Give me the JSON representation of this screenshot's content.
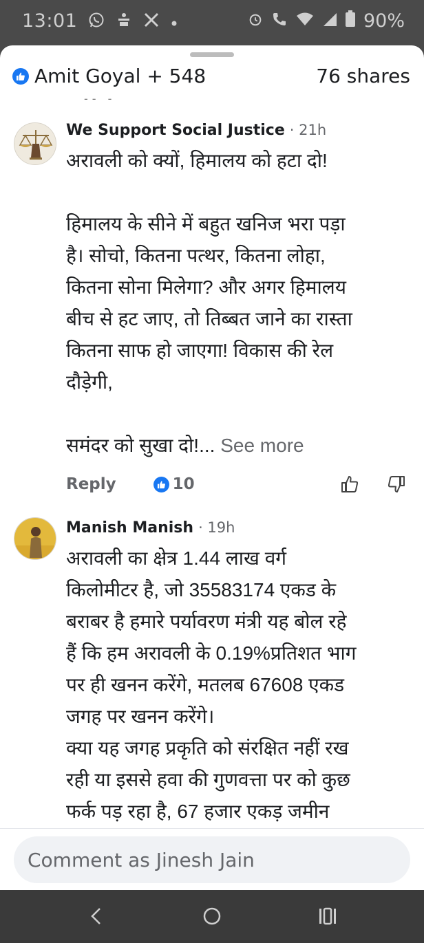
{
  "status_bar": {
    "time": "13:01",
    "left_icons": [
      "whatsapp-icon",
      "notification-app-icon",
      "x-logo-icon",
      "more-dot-icon"
    ],
    "battery": "90%",
    "right_icons": [
      "alarm-icon",
      "call-icon",
      "wifi-icon",
      "signal-icon",
      "battery-icon"
    ]
  },
  "post": {
    "reactions_text": "Amit Goyal + 548",
    "shares_text": "76 shares"
  },
  "comments": [
    {
      "author": "We Support Social Justice",
      "time": "· 21h",
      "paragraphs": [
        "अरावली को क्यों, हिमालय को हटा दो!",
        "",
        "हिमालय के सीने में बहुत खनिज भरा पड़ा",
        "है। सोचो, कितना पत्थर, कितना लोहा,",
        "कितना सोना मिलेगा? और अगर हिमालय",
        "बीच से हट जाए, तो तिब्बत जाने का रास्ता",
        "कितना साफ हो जाएगा! विकास की रेल",
        "दौड़ेगी,",
        "",
        "समंदर को सुखा दो!..."
      ],
      "see_more": " See more",
      "reply_label": "Reply",
      "like_count": "10"
    },
    {
      "author": "Manish Manish",
      "time": "· 19h",
      "paragraphs": [
        "अरावली का क्षेत्र  1.44 लाख वर्ग",
        "किलोमीटर है, जो 35583174 एकड के",
        "बराबर है हमारे पर्यावरण मंत्री यह बोल रहे",
        "हैं कि हम अरावली के 0.19%प्रतिशत भाग",
        "पर ही खनन करेंगे, मतलब 67608 एकड",
        "जगह पर खनन करेंगे।",
        "क्या यह जगह प्रकृति को संरक्षित नहीं रख",
        "रही या इससे हवा की गुणवत्ता पर को कुछ",
        "फर्क पड़ रहा है, 67 हजार एकड़ जमीन"
      ]
    }
  ],
  "composer": {
    "placeholder": "Comment as Jinesh Jain"
  },
  "colors": {
    "facebook_blue": "#1877f2",
    "secondary_text": "#65676b",
    "status_bar_bg": "#4a4a4a",
    "nav_bar_bg": "#3a3a3a"
  }
}
